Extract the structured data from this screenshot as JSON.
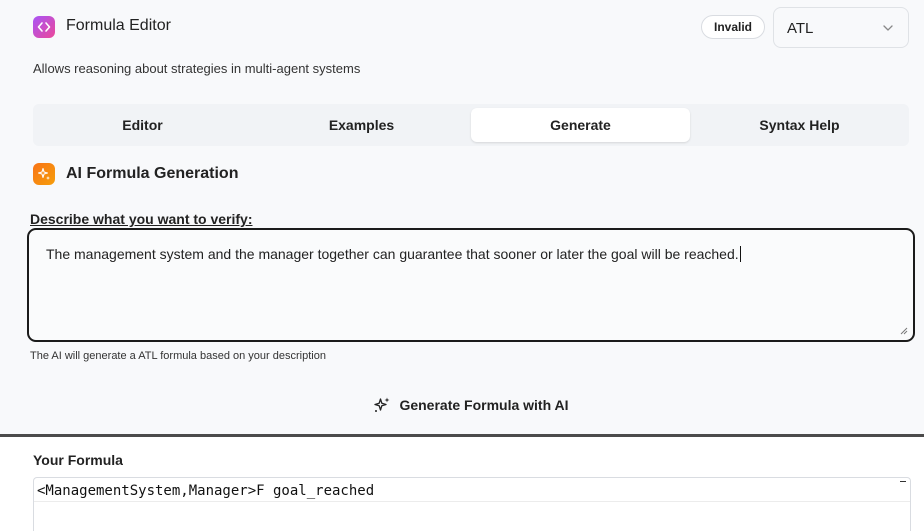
{
  "header": {
    "title": "Formula Editor",
    "icon": "code-icon",
    "status_badge": "Invalid",
    "logic_select": {
      "value": "ATL",
      "icon": "chevron-down-icon"
    },
    "subtitle": "Allows reasoning about strategies in multi-agent systems"
  },
  "tabs": [
    {
      "label": "Editor",
      "active": false
    },
    {
      "label": "Examples",
      "active": false
    },
    {
      "label": "Generate",
      "active": true
    },
    {
      "label": "Syntax Help",
      "active": false
    }
  ],
  "ai_section": {
    "heading": "AI Formula Generation",
    "icon": "sparkles-icon",
    "describe_label": "Describe what you want to verify:",
    "description_value": "The management system and the manager together can guarantee that sooner or later the goal will be reached.",
    "hint": "The AI will generate a ATL formula based on your description",
    "generate_button": "Generate Formula with AI"
  },
  "formula": {
    "label": "Your Formula",
    "value": "<ManagementSystem,Manager>F goal_reached"
  },
  "colors": {
    "header_icon_gradient": [
      "#a855f7",
      "#ec4899"
    ],
    "ai_icon_gradient": [
      "#f97316",
      "#f59e0b"
    ],
    "background": "#f8f9fb"
  }
}
